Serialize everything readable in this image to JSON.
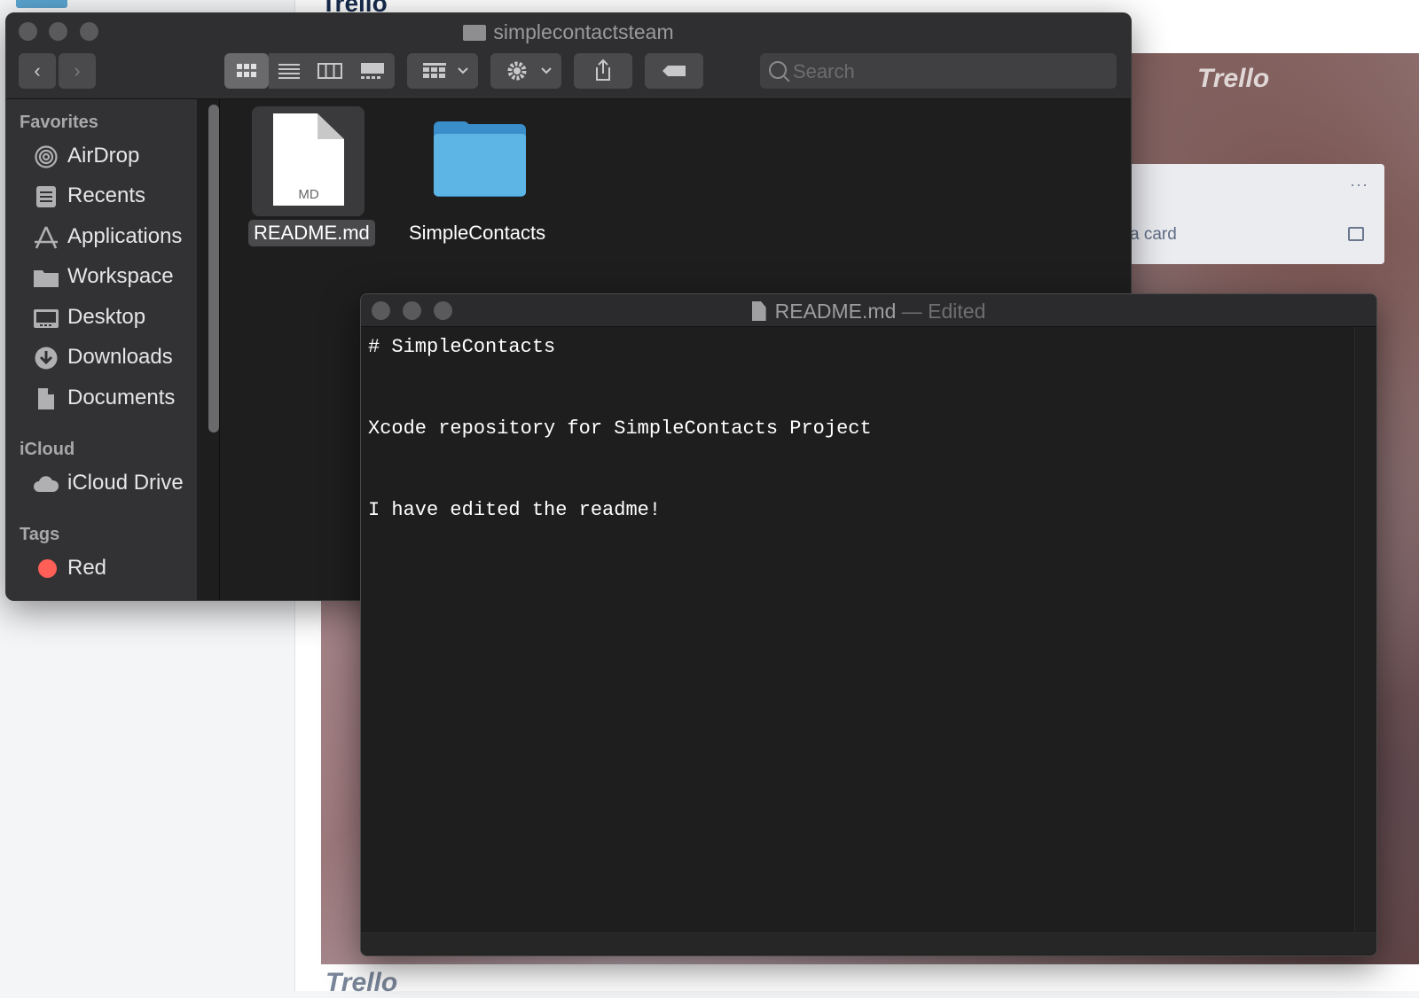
{
  "background": {
    "trello_heading": "Trello",
    "logo_text": "Trello",
    "card": {
      "menu": "···",
      "add_card_label": "a card"
    }
  },
  "finder": {
    "window_title": "simplecontactsteam",
    "toolbar": {
      "back_glyph": "‹",
      "forward_glyph": "›",
      "view_icons": [
        "icon-view-icon",
        "list-view-icon",
        "column-view-icon",
        "gallery-view-icon"
      ],
      "group_icon": "group-by-icon",
      "action_icon": "gear-icon",
      "share_icon": "share-icon",
      "tag_icon": "tag-icon",
      "search_placeholder": "Search"
    },
    "sidebar": {
      "favorites_heading": "Favorites",
      "favorites": [
        {
          "label": "AirDrop",
          "icon": "airdrop-icon"
        },
        {
          "label": "Recents",
          "icon": "recents-icon"
        },
        {
          "label": "Applications",
          "icon": "applications-icon"
        },
        {
          "label": "Workspace",
          "icon": "folder-icon"
        },
        {
          "label": "Desktop",
          "icon": "desktop-icon"
        },
        {
          "label": "Downloads",
          "icon": "downloads-icon"
        },
        {
          "label": "Documents",
          "icon": "documents-icon"
        }
      ],
      "icloud_heading": "iCloud",
      "icloud": [
        {
          "label": "iCloud Drive",
          "icon": "cloud-icon"
        }
      ],
      "tags_heading": "Tags",
      "tags": [
        {
          "label": "Red",
          "color": "#ff5f57"
        }
      ]
    },
    "files": [
      {
        "name": "README.md",
        "badge": "MD",
        "selected": true
      },
      {
        "name": "SimpleContacts",
        "kind": "folder"
      }
    ]
  },
  "editor": {
    "title": "README.md",
    "status": " — Edited",
    "content": "# SimpleContacts\n\nXcode repository for SimpleContacts Project\n\nI have edited the readme!"
  }
}
